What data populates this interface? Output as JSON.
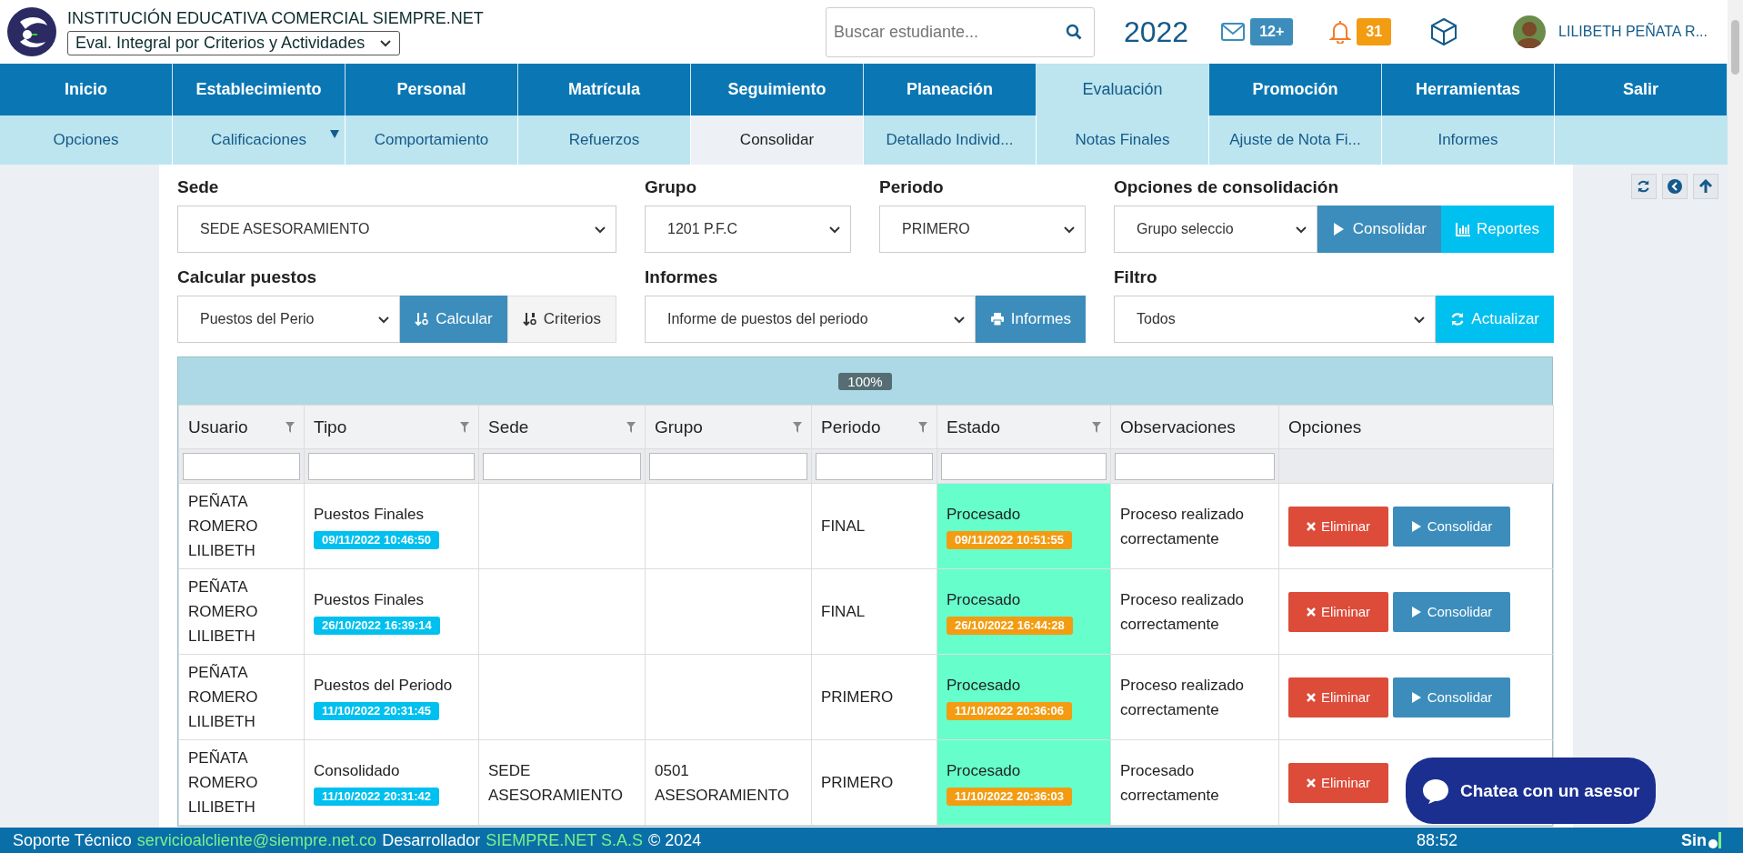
{
  "header": {
    "institution": "INSTITUCIÓN EDUCATIVA COMERCIAL SIEMPRE.NET",
    "module_select": "Eval. Integral por Criterios y Actividades",
    "search": {
      "placeholder": "Buscar estudiante..."
    },
    "year": "2022",
    "messages_badge": "12+",
    "notifications_badge": "31",
    "user": "LILIBETH PEÑATA R..."
  },
  "nav": [
    {
      "label": "Inicio",
      "selected": false
    },
    {
      "label": "Establecimiento",
      "selected": false
    },
    {
      "label": "Personal",
      "selected": false
    },
    {
      "label": "Matrícula",
      "selected": false
    },
    {
      "label": "Seguimiento",
      "selected": false
    },
    {
      "label": "Planeación",
      "selected": false
    },
    {
      "label": "Evaluación",
      "selected": true
    },
    {
      "label": "Promoción",
      "selected": false
    },
    {
      "label": "Herramientas",
      "selected": false
    },
    {
      "label": "Salir",
      "selected": false
    }
  ],
  "subnav": [
    {
      "label": "Opciones",
      "selected": false,
      "dropdown": false
    },
    {
      "label": "Calificaciones",
      "selected": false,
      "dropdown": true
    },
    {
      "label": "Comportamiento",
      "selected": false,
      "dropdown": false
    },
    {
      "label": "Refuerzos",
      "selected": false,
      "dropdown": false
    },
    {
      "label": "Consolidar",
      "selected": true,
      "dropdown": false
    },
    {
      "label": "Detallado Individ...",
      "selected": false,
      "dropdown": false
    },
    {
      "label": "Notas Finales",
      "selected": false,
      "dropdown": false
    },
    {
      "label": "Ajuste de Nota Fi...",
      "selected": false,
      "dropdown": false
    },
    {
      "label": "Informes",
      "selected": false,
      "dropdown": false
    }
  ],
  "form": [
    {
      "label": "Sede",
      "select": "SEDE ASESORAMIENTO"
    },
    {
      "label": "Grupo",
      "select": "1201 P.F.C"
    },
    {
      "label": "Periodo",
      "select": "PRIMERO"
    },
    {
      "label": "Opciones de consolidación",
      "select": "Grupo seleccio",
      "buttons": [
        {
          "kind": "consolidate",
          "label": "Consolidar"
        },
        {
          "kind": "reports",
          "label": "Reportes"
        }
      ]
    },
    {
      "label": "Calcular puestos",
      "select": "Puestos del Perio",
      "buttons": [
        {
          "kind": "calculate",
          "label": "Calcular"
        },
        {
          "kind": "criteria",
          "label": "Criterios"
        }
      ]
    },
    {
      "label": "Informes",
      "select": "Informe de puestos del periodo",
      "buttons": [
        {
          "kind": "print",
          "label": "Informes"
        }
      ]
    },
    {
      "label": "Filtro",
      "select": "Todos",
      "buttons": [
        {
          "kind": "refresh",
          "label": "Actualizar"
        }
      ]
    }
  ],
  "progress": {
    "label": "100%",
    "level": 1
  },
  "table": {
    "columns": [
      {
        "label": "Usuario",
        "filter_icon": true,
        "filter_field": true
      },
      {
        "label": "Tipo",
        "filter_icon": true,
        "filter_field": true
      },
      {
        "label": "Sede",
        "filter_icon": true,
        "filter_field": true
      },
      {
        "label": "Grupo",
        "filter_icon": true,
        "filter_field": true
      },
      {
        "label": "Periodo",
        "filter_icon": true,
        "filter_field": true
      },
      {
        "label": "Estado",
        "filter_icon": true,
        "filter_field": true
      },
      {
        "label": "Observaciones",
        "filter_icon": false,
        "filter_field": true
      },
      {
        "label": "Opciones",
        "filter_icon": false,
        "filter_field": false
      }
    ],
    "rows": [
      {
        "usuario": "PEÑATA ROMERO LILIBETH",
        "tipo": "Puestos Finales",
        "tipo_time": "09/11/2022 10:46:50",
        "periodo": "FINAL",
        "estado": "Procesado",
        "estado_time": "09/11/2022 10:51:55",
        "observaciones": "Proceso realizado correctamente",
        "actions": [
          {
            "kind": "delete",
            "label": "Eliminar"
          },
          {
            "kind": "consolidate",
            "label": "Consolidar"
          }
        ]
      },
      {
        "usuario": "PEÑATA ROMERO LILIBETH",
        "tipo": "Puestos Finales",
        "tipo_time": "26/10/2022 16:39:14",
        "periodo": "FINAL",
        "estado": "Procesado",
        "estado_time": "26/10/2022 16:44:28",
        "observaciones": "Proceso realizado correctamente",
        "actions": [
          {
            "kind": "delete",
            "label": "Eliminar"
          },
          {
            "kind": "consolidate",
            "label": "Consolidar"
          }
        ]
      },
      {
        "usuario": "PEÑATA ROMERO LILIBETH",
        "tipo": "Puestos del Periodo",
        "tipo_time": "11/10/2022 20:31:45",
        "periodo": "PRIMERO",
        "estado": "Procesado",
        "estado_time": "11/10/2022 20:36:06",
        "observaciones": "Proceso realizado correctamente",
        "actions": [
          {
            "kind": "delete",
            "label": "Eliminar"
          },
          {
            "kind": "consolidate",
            "label": "Consolidar"
          }
        ]
      },
      {
        "usuario": "PEÑATA ROMERO LILIBETH",
        "tipo": "Consolidado",
        "tipo_time": "11/10/2022 20:31:42",
        "sede": "SEDE ASESORAMIENTO",
        "grupo": "0501 ASESORAMIENTO",
        "periodo": "PRIMERO",
        "estado": "Procesado",
        "estado_time": "11/10/2022 20:36:03",
        "observaciones": "Procesado correctamente",
        "actions": [
          {
            "kind": "delete",
            "label": "Eliminar"
          }
        ]
      }
    ]
  },
  "chat": {
    "label": "Chatea con un asesor"
  },
  "footer": {
    "support_label": "Soporte Técnico",
    "support_email": "servicioalcliente@siempre.net.co",
    "developer_label": "Desarrollador",
    "developer_link": "SIEMPRE.NET S.A.S",
    "copyright": "© 2024",
    "timer": "88:52",
    "logo_text": "Sin"
  }
}
